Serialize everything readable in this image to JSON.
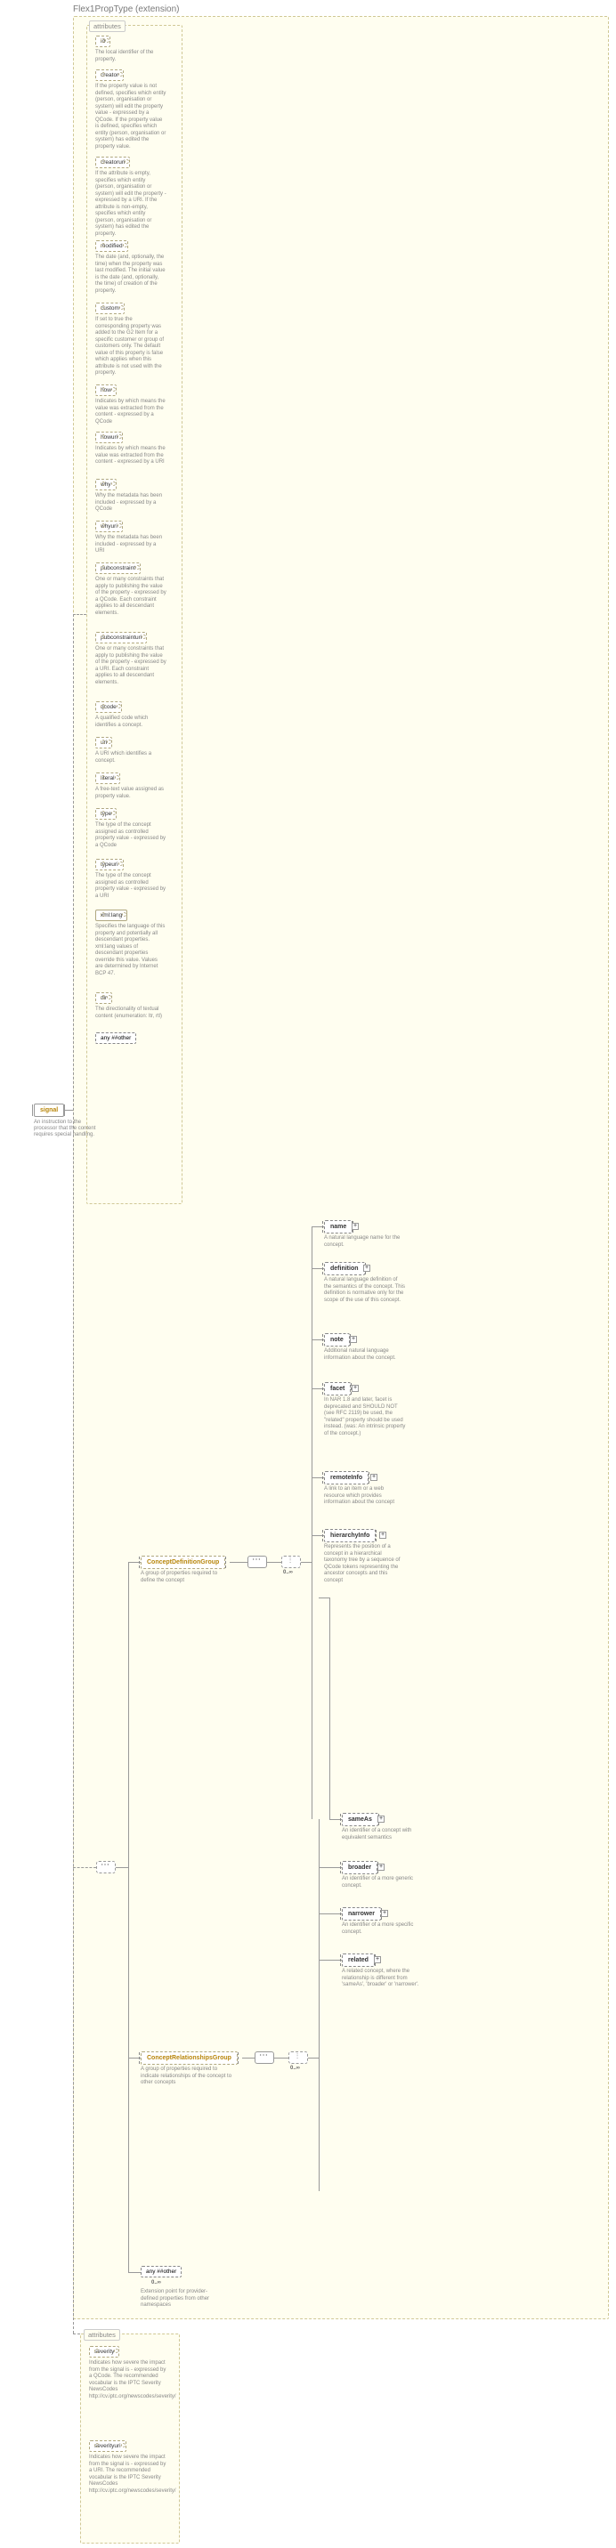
{
  "header": "Flex1PropType (extension)",
  "root": {
    "name": "signal",
    "desc": "An instruction to the processor that the content requires special handling."
  },
  "attr_section_label": "attributes",
  "attributes": [
    {
      "name": "id",
      "desc": "The local identifier of the property."
    },
    {
      "name": "creator",
      "desc": "If the property value is not defined, specifies which entity (person, organisation or system) will edit the property value - expressed by a QCode. If the property value is defined, specifies which entity (person, organisation or system) has edited the property value."
    },
    {
      "name": "creatoruri",
      "desc": "If the attribute is empty, specifies which entity (person, organisation or system) will edit the property - expressed by a URI. If the attribute is non-empty, specifies which entity (person, organisation or system) has edited the property."
    },
    {
      "name": "modified",
      "desc": "The date (and, optionally, the time) when the property was last modified. The initial value is the date (and, optionally, the time) of creation of the property."
    },
    {
      "name": "custom",
      "desc": "If set to true the corresponding property was added to the G2 Item for a specific customer or group of customers only. The default value of this property is false which applies when this attribute is not used with the property."
    },
    {
      "name": "how",
      "desc": "Indicates by which means the value was extracted from the content - expressed by a QCode"
    },
    {
      "name": "howuri",
      "desc": "Indicates by which means the value was extracted from the content - expressed by a URI"
    },
    {
      "name": "why",
      "desc": "Why the metadata has been included - expressed by a QCode"
    },
    {
      "name": "whyuri",
      "desc": "Why the metadata has been included - expressed by a URI"
    },
    {
      "name": "pubconstraint",
      "desc": "One or many constraints that apply to publishing the value of the property - expressed by a QCode. Each constraint applies to all descendant elements."
    },
    {
      "name": "pubconstrainturi",
      "desc": "One or many constraints that apply to publishing the value of the property - expressed by a URI. Each constraint applies to all descendant elements."
    },
    {
      "name": "qcode",
      "desc": "A qualified code which identifies a concept."
    },
    {
      "name": "uri",
      "desc": "A URI which identifies a concept."
    },
    {
      "name": "literal",
      "desc": "A free-text value assigned as property value."
    },
    {
      "name": "type",
      "desc": "The type of the concept assigned as controlled property value - expressed by a QCode"
    },
    {
      "name": "typeuri",
      "desc": "The type of the concept assigned as controlled property value - expressed by a URI"
    },
    {
      "name": "xml:lang",
      "desc": "Specifies the language of this property and potentially all descendant properties. xml:lang values of descendant properties override this value. Values are determined by Internet BCP 47.",
      "solid": true
    },
    {
      "name": "dir",
      "desc": "The directionality of textual content (enumeration: ltr, rtl)"
    }
  ],
  "any_other": "any ##other",
  "groups": {
    "def": {
      "name": "ConceptDefinitionGroup",
      "desc": "A group of properties required to define the concept",
      "card": "0..∞"
    },
    "rel": {
      "name": "ConceptRelationshipsGroup",
      "desc": "A group of properties required to indicate relationships of the concept to other concepts",
      "card": "0..∞"
    },
    "ext": {
      "name": "any ##other",
      "desc": "Extension point for provider-defined properties from other namespaces",
      "card": "0..∞"
    }
  },
  "def_children": [
    {
      "name": "name",
      "desc": "A natural language name for the concept."
    },
    {
      "name": "definition",
      "desc": "A natural language definition of the semantics of the concept. This definition is normative only for the scope of the use of this concept."
    },
    {
      "name": "note",
      "desc": "Additional natural language information about the concept."
    },
    {
      "name": "facet",
      "desc": "In NAR 1.8 and later, facet is deprecated and SHOULD NOT (see RFC 2119) be used, the \"related\" property should be used instead. (was: An intrinsic property of the concept.)"
    },
    {
      "name": "remoteInfo",
      "desc": "A link to an item or a web resource which provides information about the concept"
    },
    {
      "name": "hierarchyInfo",
      "desc": "Represents the position of a concept in a hierarchical taxonomy tree by a sequence of QCode tokens representing the ancestor concepts and this concept"
    }
  ],
  "rel_children": [
    {
      "name": "sameAs",
      "desc": "An identifier of a concept with equivalent semantics"
    },
    {
      "name": "broader",
      "desc": "An identifier of a more generic concept."
    },
    {
      "name": "narrower",
      "desc": "An identifier of a more specific concept."
    },
    {
      "name": "related",
      "desc": "A related concept, where the relationship is different from 'sameAs', 'broader' or 'narrower'."
    }
  ],
  "severity_attrs": [
    {
      "name": "severity",
      "desc": "Indicates how severe the impact from the signal is - expressed by a QCode. The recommended vocabular is the IPTC Severity NewsCodes http://cv.iptc.org/newscodes/severity/"
    },
    {
      "name": "severityuri",
      "desc": "Indicates how severe the impact from the signal is - expressed by a URI. The recommended vocabular is the IPTC Severity NewsCodes http://cv.iptc.org/newscodes/severity/"
    }
  ]
}
